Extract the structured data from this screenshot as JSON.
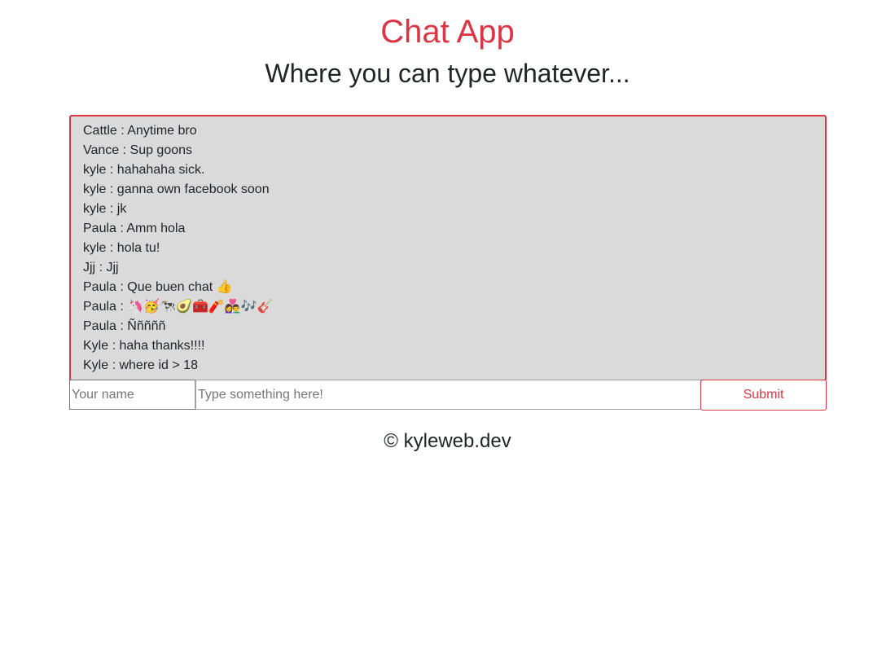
{
  "header": {
    "title": "Chat App",
    "subtitle": "Where you can type whatever..."
  },
  "chat": {
    "messages": [
      {
        "text": "Cattle : Anytime bro"
      },
      {
        "text": "Vance : Sup goons"
      },
      {
        "text": "kyle : hahahaha sick."
      },
      {
        "text": "kyle : ganna own facebook soon"
      },
      {
        "text": "kyle : jk"
      },
      {
        "text": "Paula : Amm hola"
      },
      {
        "text": "kyle : hola tu!"
      },
      {
        "text": "Jjj : Jjj"
      },
      {
        "text": "Paula : Que buen chat 👍"
      },
      {
        "text": "Paula : 🦄🥳🐄🥑🧰🧨👩‍❤️‍👨🎶🎸"
      },
      {
        "text": "Paula : Ñññññ"
      },
      {
        "text": "Kyle : haha thanks!!!!"
      },
      {
        "text": "Kyle : where id > 18"
      }
    ]
  },
  "form": {
    "name_placeholder": "Your name",
    "name_value": "",
    "message_placeholder": "Type something here!",
    "message_value": "",
    "submit_label": "Submit"
  },
  "footer": {
    "text": "© kyleweb.dev"
  },
  "colors": {
    "accent": "#dc3545",
    "chat_background": "#dadada",
    "text": "#212529"
  }
}
